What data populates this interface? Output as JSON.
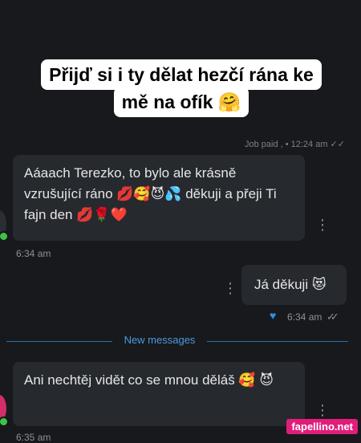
{
  "caption": {
    "line1": "Přijď si i ty dělat hezčí rána ke",
    "line2": "mě na ofík 🤗"
  },
  "faded_status": "Job paid , • 12:24 am ✓✓",
  "messages": [
    {
      "text": "Aáaach Terezko, to bylo ale krásně vzrušující ráno 💋🥰😈💦 děkuji a přeji Ti fajn den 💋🌹❤️",
      "time": "6:34 am"
    },
    {
      "text": "Já děkuji 😻",
      "time": "6:34 am"
    },
    {
      "text": "Ani nechtěj vidět co se mnou děláš 🥰 😈",
      "time": "6:35 am"
    }
  ],
  "divider_label": "New messages",
  "watermark": "fapellino.net",
  "icons": {
    "kebab": "⋮",
    "heart": "♥",
    "ticks": "✓✓"
  },
  "colors": {
    "background": "#17191c",
    "bubble": "#26292e",
    "accent": "#4a9ae0",
    "online": "#3ec24b",
    "watermark": "#e01e7a"
  }
}
